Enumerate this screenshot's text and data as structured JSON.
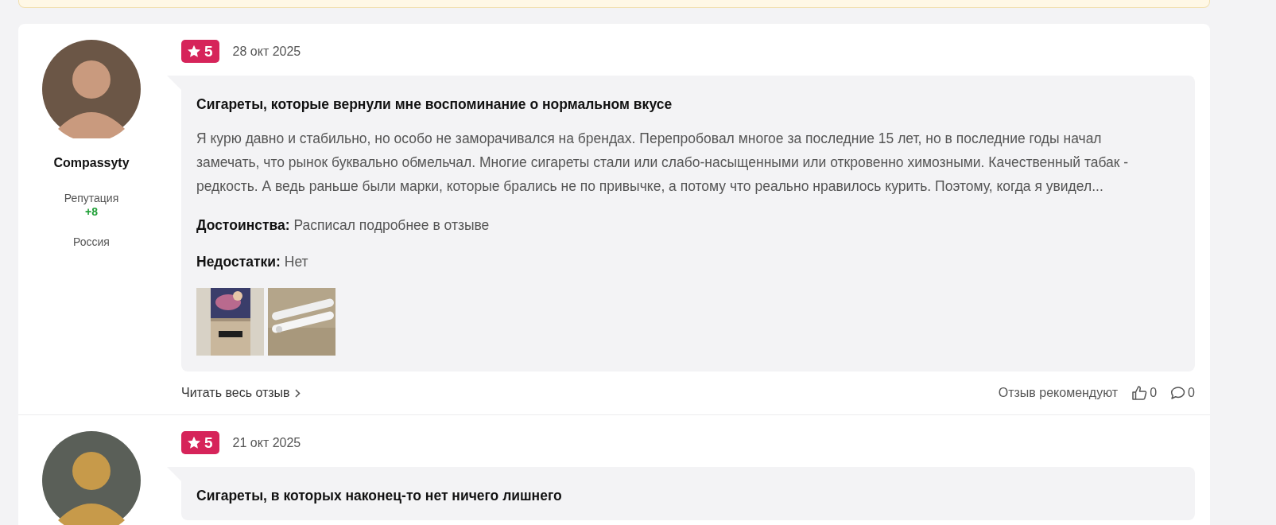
{
  "reviews": [
    {
      "author": {
        "name": "Compassyty",
        "reputation_label": "Репутация",
        "reputation": "+8",
        "country": "Россия"
      },
      "rating": "5",
      "date": "28 окт 2025",
      "title": "Сигареты, которые вернули мне воспоминание о нормальном вкусе",
      "text": "Я курю давно и стабильно, но особо не заморачивался на брендах. Перепробовал многое за последние 15 лет, но в последние годы начал замечать, что рынок буквально обмельчал. Многие сигареты стали или слабо-насыщенными или откровенно химозными. Качественный табак - редкость. А ведь раньше были марки, которые брались не по привычке, а потому что реально нравилось курить. Поэтому, когда я увидел...",
      "pros_label": "Достоинства:",
      "pros": "Расписал подробнее в отзыве",
      "cons_label": "Недостатки:",
      "cons": "Нет",
      "read_more": "Читать весь отзыв",
      "recommend_label": "Отзыв рекомендуют",
      "likes": "0",
      "comments": "0"
    },
    {
      "rating": "5",
      "date": "21 окт 2025",
      "title": "Сигареты, в которых наконец-то нет ничего лишнего"
    }
  ]
}
